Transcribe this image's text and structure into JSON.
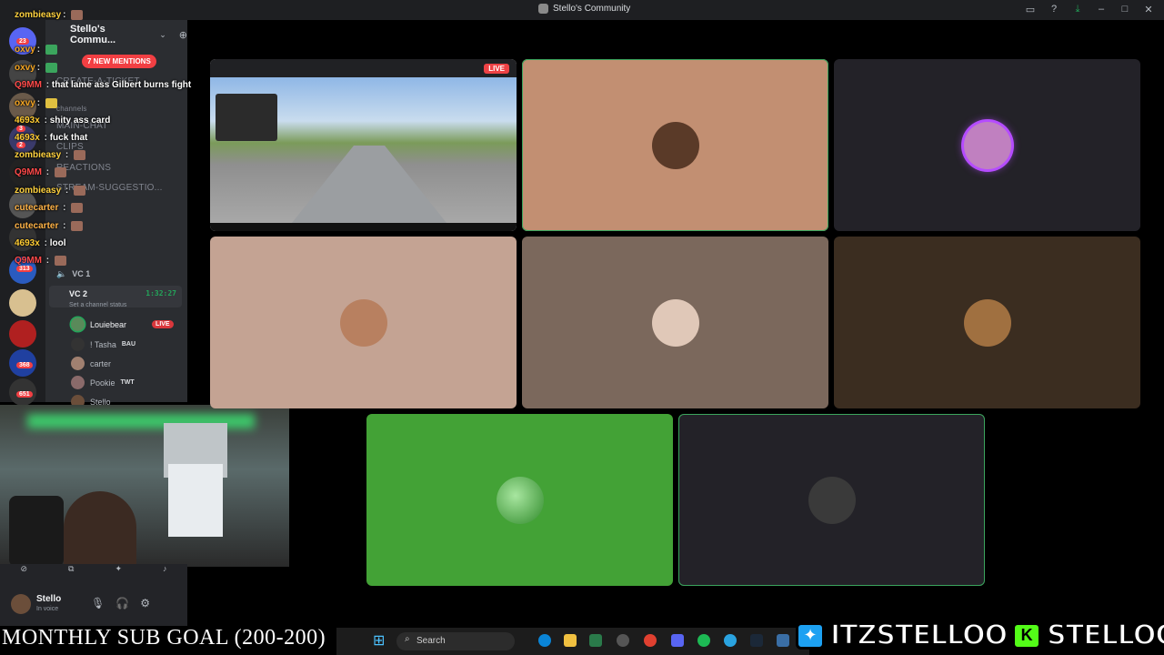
{
  "window": {
    "title": "Stello's Community"
  },
  "server": {
    "name": "Stello's Commu...",
    "new_mentions": "7 NEW MENTIONS",
    "channels": [
      "CREATE-A-TICKET",
      "MAIN-CHAT",
      "CLIPS",
      "REACTIONS",
      "STREAM-SUGGESTIO..."
    ],
    "category": "channels",
    "server_badges": [
      "23",
      "3",
      "2",
      "3",
      "313",
      "368",
      "651"
    ]
  },
  "voice": {
    "vc1": "VC 1",
    "vc2": "VC 2",
    "vc2_time": "1:32:27",
    "vc2_status": "Set a channel status",
    "members": [
      {
        "name": "Louiebear",
        "badge": "LIVE"
      },
      {
        "name": "! Tasha",
        "badge": "BAU"
      },
      {
        "name": "carter",
        "badge": ""
      },
      {
        "name": "Pookie",
        "badge": "TWT"
      },
      {
        "name": "Stello",
        "badge": ""
      }
    ]
  },
  "chat": [
    {
      "user": "zombieasy",
      "text": "",
      "color": "#ffd23f"
    },
    {
      "user": "oxvy",
      "text": "",
      "color": "#f5a623"
    },
    {
      "user": "oxvy",
      "text": "",
      "color": "#f5a623"
    },
    {
      "user": "Q9MM",
      "text": "that lame ass Gilbert burns fight",
      "color": "#ff4a4a"
    },
    {
      "user": "oxvy",
      "text": "",
      "color": "#f5a623"
    },
    {
      "user": "4693x",
      "text": "shity ass card",
      "color": "#ffcc33"
    },
    {
      "user": "4693x",
      "text": "fuck that",
      "color": "#ffcc33"
    },
    {
      "user": "zombieasy",
      "text": "",
      "color": "#ffd23f"
    },
    {
      "user": "Q9MM",
      "text": "",
      "color": "#ff4a4a"
    },
    {
      "user": "zombieasy",
      "text": "",
      "color": "#ffd23f"
    },
    {
      "user": "cutecarter",
      "text": "",
      "color": "#ffb347"
    },
    {
      "user": "cutecarter",
      "text": "",
      "color": "#ffb347"
    },
    {
      "user": "4693x",
      "text": "lool",
      "color": "#ffcc33"
    },
    {
      "user": "Q9MM",
      "text": "",
      "color": "#ff4a4a"
    }
  ],
  "user_panel": {
    "name": "Stello",
    "status": "In voice"
  },
  "screenshare": {
    "live": "LIVE"
  },
  "tiles": [
    {
      "bg": "#c28f72",
      "avatar": "#5a3a28"
    },
    {
      "bg": "#232228",
      "avatar": "#c080c0"
    },
    {
      "bg": "#c4a393",
      "avatar": "#b88060"
    },
    {
      "bg": "#7b685c",
      "avatar": "#e0c8b8"
    },
    {
      "bg": "#3b2d20",
      "avatar": "#a07040"
    },
    {
      "bg": "#43a236",
      "avatar": "#2f8a2a"
    },
    {
      "bg": "#232228",
      "avatar": "#3a3a3a"
    }
  ],
  "overlay": {
    "sub_goal": "MONTHLY SUB GOAL (200-200)",
    "twitter": "ITZSTELLOO",
    "kick": "STELLOOO"
  },
  "taskbar": {
    "search": "Search"
  }
}
